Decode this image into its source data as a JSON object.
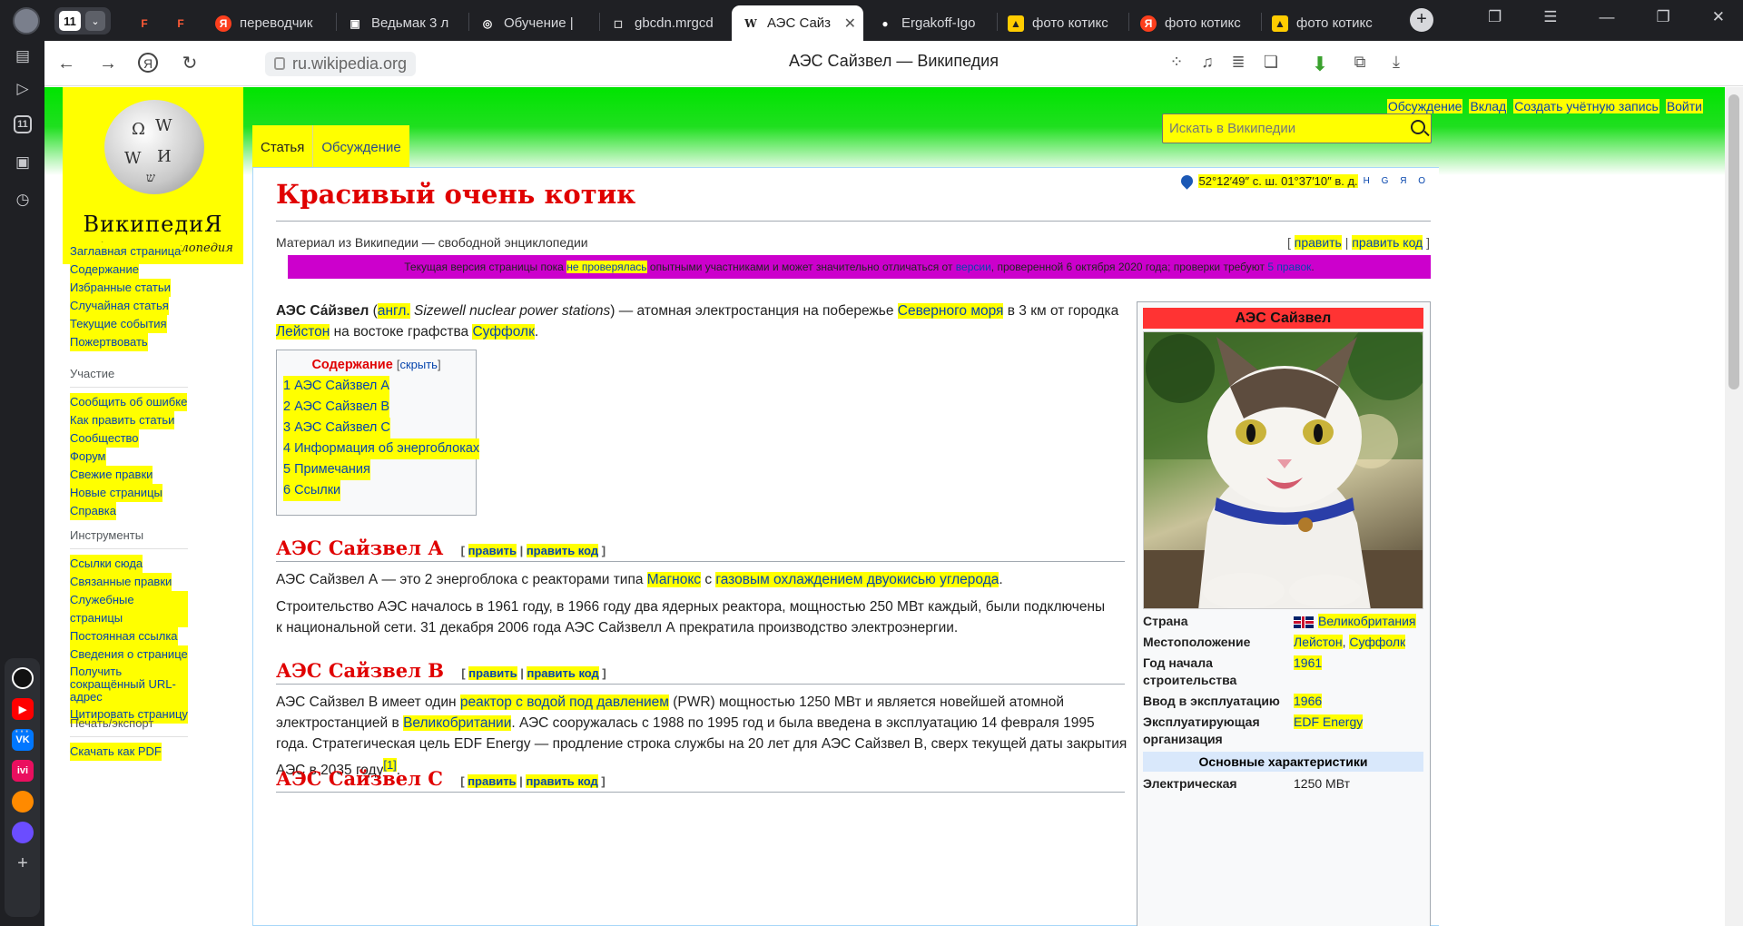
{
  "browser": {
    "group_count": "11",
    "tabs": [
      {
        "label": "",
        "favicon": "F"
      },
      {
        "label": "",
        "favicon": "F"
      },
      {
        "label": "переводчик",
        "favicon": "Я"
      },
      {
        "label": "Ведьмак 3 л",
        "favicon": "▣"
      },
      {
        "label": "Обучение |",
        "favicon": "◎"
      },
      {
        "label": "gbcdn.mrgcd",
        "favicon": "◻"
      },
      {
        "label": "АЭС Сайз",
        "favicon": "W"
      },
      {
        "label": "Ergakoff-Igo",
        "favicon": "●"
      },
      {
        "label": "фото котикс",
        "favicon": "▲"
      },
      {
        "label": "фото котикс",
        "favicon": "Я"
      },
      {
        "label": "фото котикс",
        "favicon": "▲"
      }
    ],
    "url": "ru.wikipedia.org",
    "page_title": "АЭС Сайзвел — Википедия",
    "sidebar_badge": "11"
  },
  "logo": {
    "title": "ВикипедиЯ",
    "subtitle": "Свободная энциклопедия"
  },
  "personal": [
    "Обсуждение",
    "Вклад",
    "Создать учётную запись",
    "Войти"
  ],
  "tabs": {
    "article": "Статья",
    "talk": "Обсуждение"
  },
  "search": {
    "placeholder": "Искать в Википедии"
  },
  "nav": {
    "main": [
      "Заглавная страница",
      "Содержание",
      "Избранные статьи",
      "Случайная статья",
      "Текущие события",
      "Пожертвовать"
    ],
    "participation_head": "Участие",
    "participation": [
      "Сообщить об ошибке",
      "Как править статьи",
      "Сообщество",
      "Форум",
      "Свежие правки",
      "Новые страницы",
      "Справка"
    ],
    "tools_head": "Инструменты",
    "tools": [
      "Ссылки сюда",
      "Связанные правки",
      "Служебные страницы",
      "Постоянная ссылка",
      "Сведения о странице",
      "Получить сокращённый URL-адрес",
      "Цитировать страницу"
    ],
    "print_head": "Печать/экспорт",
    "print": [
      "Скачать как PDF"
    ]
  },
  "article": {
    "title": "Красивый очень котик",
    "coords": "52°12′49″ с. ш. 01°37′10″ в. д.",
    "coords_extra": "H G Я O",
    "sitesub": "Материал из Википедии — свободной энциклопедии",
    "edit": "править",
    "edit_code": "править код",
    "notice_pre": "Текущая версия страницы пока",
    "notice_link": "не проверялась",
    "notice_mid": "опытными участниками и может значительно отличаться от",
    "notice_link2": "версии",
    "notice_post": ", проверенной 6 октября 2020 года; проверки требуют",
    "notice_link3": "5 правок",
    "intro_bold": "АЭС Са́йзвел",
    "intro_lang": "англ.",
    "intro_en": "Sizewell nuclear power stations",
    "intro_1": "— атомная электростанция на побережье",
    "intro_sea": "Северного моря",
    "intro_2": "в 3 км от городка",
    "intro_town": "Лейстон",
    "intro_3": "на востоке графства",
    "intro_county": "Суффолк",
    "toc_title": "Содержание",
    "toc_hide": "скрыть",
    "toc": [
      "1  АЭС Сайзвел А",
      "2  АЭС Сайзвел B",
      "3  АЭС Сайзвел C",
      "4  Информация об энергоблоках",
      "5  Примечания",
      "6  Ссылки"
    ],
    "secA_title": "АЭС Сайзвел А",
    "secA_p1_a": "АЭС Сайзвел А — это 2 энергоблока с реакторами типа",
    "secA_p1_link1": "Магнокс",
    "secA_p1_b": "с",
    "secA_p1_link2": "газовым охлаждением двуокисью углерода",
    "secA_p2": "Строительство АЭС началось в 1961 году, в 1966 году два ядерных реактора, мощностью 250 МВт каждый, были подключены к национальной сети. 31 декабря 2006 года АЭС Сайзвелл А прекратила производство электроэнергии.",
    "secB_title": "АЭС Сайзвел B",
    "secB_a": "АЭС Сайзвел B имеет один",
    "secB_link1": "реактор с водой под давлением",
    "secB_b": "(PWR) мощностью 1250 МВт и является новейшей атомной электростанцией в",
    "secB_link2": "Великобритании",
    "secB_c": ". АЭС сооружалась с 1988 по 1995 год и была введена в эксплуатацию 14 февраля 1995 года. Стратегическая цель EDF Energy — продление строка службы на 20 лет для АЭС Сайзвел B, сверх текущей даты закрытия АЭС в 2035 году",
    "secB_ref": "[1]",
    "secC_title": "АЭС Сайзвел C"
  },
  "infobox": {
    "title": "АЭС Сайзвел",
    "rows": [
      {
        "label": "Страна",
        "value": "Великобритания"
      },
      {
        "label": "Местоположение",
        "value1": "Лейстон",
        "value2": "Суффолк"
      },
      {
        "label": "Год начала строительства",
        "value": "1961"
      },
      {
        "label": "Ввод в эксплуатацию",
        "value": "1966"
      },
      {
        "label": "Эксплуатирующая организация",
        "value": "EDF Energy"
      }
    ],
    "subheader": "Основные характеристики",
    "power_label": "Электрическая",
    "power_value": "1250 МВт"
  },
  "colors": {
    "highlight": "#ffff00",
    "header_green": "#00e400",
    "title_red": "#e00000",
    "notice_magenta": "#cc00cc"
  }
}
